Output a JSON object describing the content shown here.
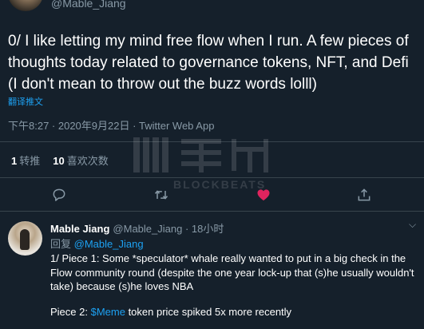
{
  "tweet": {
    "handle": "@Mable_Jiang",
    "text": "0/ I like letting my mind free flow when I run. A few pieces of thoughts today related to governance tokens, NFT, and Defi (I don't mean to throw out the buzz words lolll)",
    "translate_label": "翻译推文",
    "meta": "下午8:27 · 2020年9月22日 · Twitter Web App"
  },
  "stats": {
    "retweets_count": "1",
    "retweets_label": "转推",
    "likes_count": "10",
    "likes_label": "喜欢次数"
  },
  "watermark": {
    "text": "BLOCKBEATS"
  },
  "actions": [
    {
      "icon": "reply-icon"
    },
    {
      "icon": "retweet-icon"
    },
    {
      "icon": "heart-icon"
    },
    {
      "icon": "share-icon"
    }
  ],
  "colors": {
    "background": "#15202b",
    "accent": "#1da1f2",
    "like": "#e0245e",
    "muted": "#8899a6",
    "divider": "#38444d"
  },
  "reply": {
    "name": "Mable Jiang",
    "handle": "@Mable_Jiang",
    "time": "· 18小时",
    "replying_label": "回复",
    "replying_to": "@Mable_Jiang",
    "body": "1/ Piece 1: Some *speculator* whale really wanted to put in a big check in the Flow community round (despite the one year lock-up that (s)he usually wouldn't take) because (s)he loves NBA",
    "piece2_prefix": "Piece 2: ",
    "piece2_cashtag": "$Meme",
    "piece2_suffix": " token price spiked 5x more recently"
  }
}
